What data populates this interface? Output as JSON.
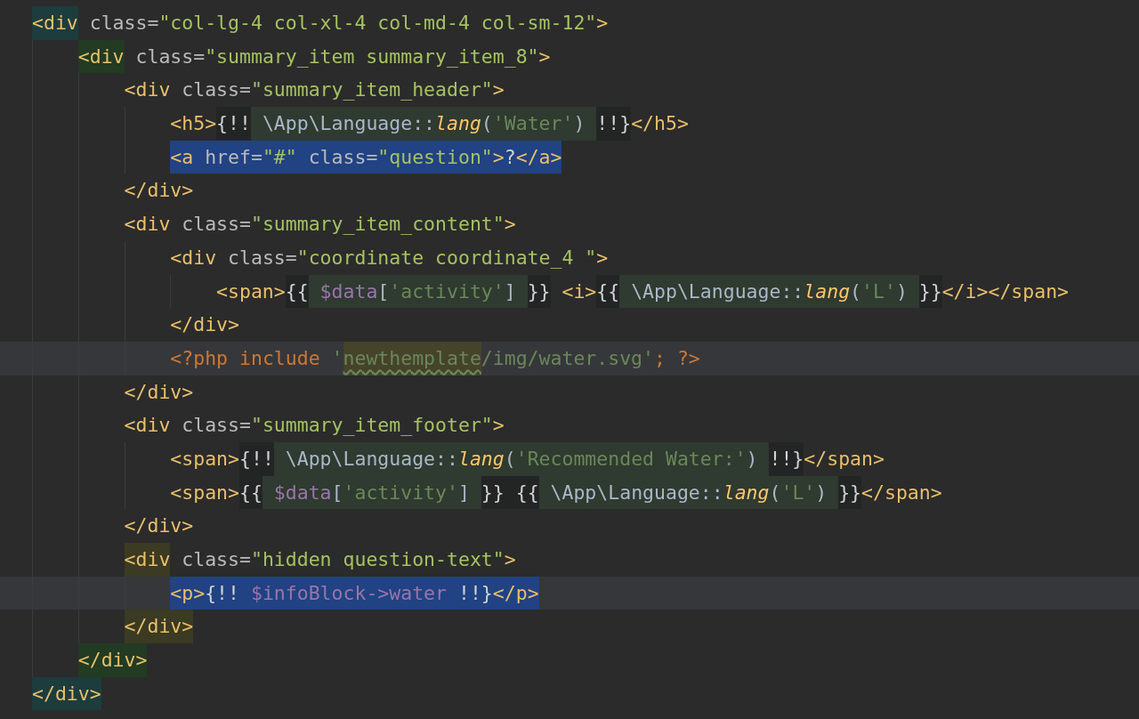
{
  "lines": [
    {
      "caret_line": false,
      "segments": [
        {
          "kind": "match",
          "tokens": [
            {
              "kind": "tag",
              "text": "<div"
            }
          ]
        },
        {
          "kind": "code",
          "tokens": [
            {
              "kind": "attr",
              "text": " class="
            },
            {
              "kind": "str",
              "text": "\"col-lg-4 col-xl-4 col-md-4 col-sm-12\""
            },
            {
              "kind": "tag",
              "text": ">"
            }
          ]
        }
      ],
      "children": [
        {
          "caret_line": false,
          "segments": [
            {
              "kind": "match",
              "tokens": [
                {
                  "kind": "tag",
                  "text": "<div"
                }
              ]
            },
            {
              "kind": "code",
              "tokens": [
                {
                  "kind": "attr",
                  "text": " class="
                },
                {
                  "kind": "str",
                  "text": "\"summary_item summary_item_8\""
                },
                {
                  "kind": "tag",
                  "text": ">"
                }
              ]
            }
          ],
          "children": [
            {
              "caret_line": false,
              "segments": [
                {
                  "kind": "code",
                  "tokens": [
                    {
                      "kind": "tag",
                      "text": "<div"
                    },
                    {
                      "kind": "attr",
                      "text": " class="
                    },
                    {
                      "kind": "str",
                      "text": "\"summary_item_header\""
                    },
                    {
                      "kind": "tag",
                      "text": ">"
                    }
                  ]
                }
              ],
              "children": [
                {
                  "caret_line": false,
                  "segments": [
                    {
                      "kind": "code",
                      "tokens": [
                        {
                          "kind": "tag",
                          "text": "<h5>"
                        }
                      ]
                    },
                    {
                      "kind": "echo",
                      "tokens": [
                        {
                          "kind": "plain",
                          "text": "{!!"
                        }
                      ]
                    },
                    {
                      "kind": "inject",
                      "tokens": [
                        {
                          "kind": "path",
                          "text": " \\App\\Language::"
                        },
                        {
                          "kind": "method",
                          "text": "lang"
                        },
                        {
                          "kind": "path",
                          "text": "("
                        },
                        {
                          "kind": "quote",
                          "text": "'Water'"
                        },
                        {
                          "kind": "path",
                          "text": ") "
                        }
                      ]
                    },
                    {
                      "kind": "echo",
                      "tokens": [
                        {
                          "kind": "plain",
                          "text": "!!}"
                        }
                      ]
                    },
                    {
                      "kind": "code",
                      "tokens": [
                        {
                          "kind": "tag",
                          "text": "</h5>"
                        }
                      ]
                    }
                  ]
                },
                {
                  "caret_line": false,
                  "segments": [
                    {
                      "kind": "selection",
                      "tokens": [
                        {
                          "kind": "tag",
                          "text": "<a"
                        },
                        {
                          "kind": "attr",
                          "text": " href="
                        },
                        {
                          "kind": "str",
                          "text": "\"#\""
                        },
                        {
                          "kind": "attr",
                          "text": " class="
                        },
                        {
                          "kind": "str",
                          "text": "\"question\""
                        },
                        {
                          "kind": "tag",
                          "text": ">"
                        },
                        {
                          "kind": "plain",
                          "text": "?"
                        },
                        {
                          "kind": "tag",
                          "text": "</a>"
                        }
                      ]
                    }
                  ]
                }
              ]
            },
            {
              "caret_line": false,
              "segments": [
                {
                  "kind": "code",
                  "tokens": [
                    {
                      "kind": "tag",
                      "text": "</div>"
                    }
                  ]
                }
              ]
            },
            {
              "caret_line": false,
              "segments": [
                {
                  "kind": "code",
                  "tokens": [
                    {
                      "kind": "tag",
                      "text": "<div"
                    },
                    {
                      "kind": "attr",
                      "text": " class="
                    },
                    {
                      "kind": "str",
                      "text": "\"summary_item_content\""
                    },
                    {
                      "kind": "tag",
                      "text": ">"
                    }
                  ]
                }
              ],
              "children": [
                {
                  "caret_line": false,
                  "segments": [
                    {
                      "kind": "code",
                      "tokens": [
                        {
                          "kind": "tag",
                          "text": "<div"
                        },
                        {
                          "kind": "attr",
                          "text": " class="
                        },
                        {
                          "kind": "str",
                          "text": "\"coordinate coordinate_4 \""
                        },
                        {
                          "kind": "tag",
                          "text": ">"
                        }
                      ]
                    }
                  ],
                  "children": [
                    {
                      "caret_line": false,
                      "segments": [
                        {
                          "kind": "code",
                          "tokens": [
                            {
                              "kind": "tag",
                              "text": "<span>"
                            }
                          ]
                        },
                        {
                          "kind": "echo",
                          "tokens": [
                            {
                              "kind": "plain",
                              "text": "{{"
                            }
                          ]
                        },
                        {
                          "kind": "inject",
                          "tokens": [
                            {
                              "kind": "var",
                              "text": " $data"
                            },
                            {
                              "kind": "path",
                              "text": "["
                            },
                            {
                              "kind": "quote",
                              "text": "'activity'"
                            },
                            {
                              "kind": "path",
                              "text": "] "
                            }
                          ]
                        },
                        {
                          "kind": "echo",
                          "tokens": [
                            {
                              "kind": "plain",
                              "text": "}}"
                            }
                          ]
                        },
                        {
                          "kind": "code",
                          "tokens": [
                            {
                              "kind": "tag",
                              "text": " <i>"
                            }
                          ]
                        },
                        {
                          "kind": "echo",
                          "tokens": [
                            {
                              "kind": "plain",
                              "text": "{{"
                            }
                          ]
                        },
                        {
                          "kind": "inject",
                          "tokens": [
                            {
                              "kind": "path",
                              "text": " \\App\\Language::"
                            },
                            {
                              "kind": "method",
                              "text": "lang"
                            },
                            {
                              "kind": "path",
                              "text": "("
                            },
                            {
                              "kind": "quote",
                              "text": "'L'"
                            },
                            {
                              "kind": "path",
                              "text": ") "
                            }
                          ]
                        },
                        {
                          "kind": "echo",
                          "tokens": [
                            {
                              "kind": "plain",
                              "text": "}}"
                            }
                          ]
                        },
                        {
                          "kind": "code",
                          "tokens": [
                            {
                              "kind": "tag",
                              "text": "</i></span>"
                            }
                          ]
                        }
                      ]
                    }
                  ]
                },
                {
                  "caret_line": false,
                  "segments": [
                    {
                      "kind": "code",
                      "tokens": [
                        {
                          "kind": "tag",
                          "text": "</div>"
                        }
                      ]
                    }
                  ]
                },
                {
                  "caret_line": true,
                  "segments": [
                    {
                      "kind": "code",
                      "tokens": [
                        {
                          "kind": "php",
                          "text": "<?php include "
                        },
                        {
                          "kind": "quote",
                          "text": "'"
                        }
                      ]
                    },
                    {
                      "kind": "typo",
                      "tokens": [
                        {
                          "kind": "quote",
                          "text": "newthemplate"
                        }
                      ]
                    },
                    {
                      "kind": "code",
                      "tokens": [
                        {
                          "kind": "quote",
                          "text": "/img/water.svg'"
                        },
                        {
                          "kind": "php",
                          "text": "; ?>"
                        }
                      ]
                    }
                  ]
                }
              ]
            },
            {
              "caret_line": false,
              "segments": [
                {
                  "kind": "code",
                  "tokens": [
                    {
                      "kind": "tag",
                      "text": "</div>"
                    }
                  ]
                }
              ]
            },
            {
              "caret_line": false,
              "segments": [
                {
                  "kind": "code",
                  "tokens": [
                    {
                      "kind": "tag",
                      "text": "<div"
                    },
                    {
                      "kind": "attr",
                      "text": " class="
                    },
                    {
                      "kind": "str",
                      "text": "\"summary_item_footer\""
                    },
                    {
                      "kind": "tag",
                      "text": ">"
                    }
                  ]
                }
              ],
              "children": [
                {
                  "caret_line": false,
                  "segments": [
                    {
                      "kind": "code",
                      "tokens": [
                        {
                          "kind": "tag",
                          "text": "<span>"
                        }
                      ]
                    },
                    {
                      "kind": "echo",
                      "tokens": [
                        {
                          "kind": "plain",
                          "text": "{!!"
                        }
                      ]
                    },
                    {
                      "kind": "inject",
                      "tokens": [
                        {
                          "kind": "path",
                          "text": " \\App\\Language::"
                        },
                        {
                          "kind": "method",
                          "text": "lang"
                        },
                        {
                          "kind": "path",
                          "text": "("
                        },
                        {
                          "kind": "quote",
                          "text": "'Recommended Water:'"
                        },
                        {
                          "kind": "path",
                          "text": ") "
                        }
                      ]
                    },
                    {
                      "kind": "echo",
                      "tokens": [
                        {
                          "kind": "plain",
                          "text": "!!}"
                        }
                      ]
                    },
                    {
                      "kind": "code",
                      "tokens": [
                        {
                          "kind": "tag",
                          "text": "</span>"
                        }
                      ]
                    }
                  ]
                },
                {
                  "caret_line": false,
                  "segments": [
                    {
                      "kind": "code",
                      "tokens": [
                        {
                          "kind": "tag",
                          "text": "<span>"
                        }
                      ]
                    },
                    {
                      "kind": "echo",
                      "tokens": [
                        {
                          "kind": "plain",
                          "text": "{{"
                        }
                      ]
                    },
                    {
                      "kind": "inject",
                      "tokens": [
                        {
                          "kind": "var",
                          "text": " $data"
                        },
                        {
                          "kind": "path",
                          "text": "["
                        },
                        {
                          "kind": "quote",
                          "text": "'activity'"
                        },
                        {
                          "kind": "path",
                          "text": "] "
                        }
                      ]
                    },
                    {
                      "kind": "echo",
                      "tokens": [
                        {
                          "kind": "plain",
                          "text": "}} {{"
                        }
                      ]
                    },
                    {
                      "kind": "inject",
                      "tokens": [
                        {
                          "kind": "path",
                          "text": " \\App\\Language::"
                        },
                        {
                          "kind": "method",
                          "text": "lang"
                        },
                        {
                          "kind": "path",
                          "text": "("
                        },
                        {
                          "kind": "quote",
                          "text": "'L'"
                        },
                        {
                          "kind": "path",
                          "text": ") "
                        }
                      ]
                    },
                    {
                      "kind": "echo",
                      "tokens": [
                        {
                          "kind": "plain",
                          "text": "}}"
                        }
                      ]
                    },
                    {
                      "kind": "code",
                      "tokens": [
                        {
                          "kind": "tag",
                          "text": "</span>"
                        }
                      ]
                    }
                  ]
                }
              ]
            },
            {
              "caret_line": false,
              "segments": [
                {
                  "kind": "code",
                  "tokens": [
                    {
                      "kind": "tag",
                      "text": "</div>"
                    }
                  ]
                }
              ]
            },
            {
              "caret_line": false,
              "segments": [
                {
                  "kind": "match",
                  "tokens": [
                    {
                      "kind": "tag",
                      "text": "<div"
                    }
                  ]
                },
                {
                  "kind": "code",
                  "tokens": [
                    {
                      "kind": "attr",
                      "text": " class="
                    },
                    {
                      "kind": "str",
                      "text": "\"hidden question-text\""
                    },
                    {
                      "kind": "tag",
                      "text": ">"
                    }
                  ]
                }
              ],
              "children": [
                {
                  "caret_line": true,
                  "segments": [
                    {
                      "kind": "selection",
                      "tokens": [
                        {
                          "kind": "tag",
                          "text": "<p>"
                        },
                        {
                          "kind": "plain",
                          "text": "{!! "
                        },
                        {
                          "kind": "var",
                          "text": "$infoBlock->water"
                        },
                        {
                          "kind": "plain",
                          "text": " !!}"
                        },
                        {
                          "kind": "tag",
                          "text": "</p>"
                        }
                      ]
                    }
                  ]
                }
              ]
            },
            {
              "caret_line": false,
              "segments": [
                {
                  "kind": "match",
                  "tokens": [
                    {
                      "kind": "tag",
                      "text": "</div>"
                    }
                  ]
                }
              ]
            }
          ]
        },
        {
          "caret_line": false,
          "segments": [
            {
              "kind": "match",
              "tokens": [
                {
                  "kind": "tag",
                  "text": "</div>"
                }
              ]
            }
          ]
        }
      ]
    },
    {
      "caret_line": false,
      "segments": [
        {
          "kind": "match",
          "tokens": [
            {
              "kind": "tag",
              "text": "</div>"
            }
          ]
        }
      ]
    }
  ]
}
